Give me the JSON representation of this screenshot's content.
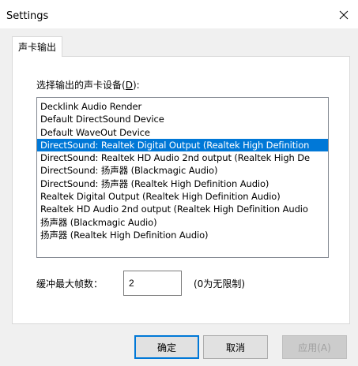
{
  "window": {
    "title": "Settings",
    "close_label": "×"
  },
  "tabs": [
    {
      "label": "声卡输出",
      "active": true
    }
  ],
  "device_group": {
    "label": "选择输出的声卡设备(D):",
    "label_prefix": "选择输出的声卡设备(",
    "label_accel": "D",
    "label_suffix": "):"
  },
  "devices": {
    "items": [
      "Decklink Audio Render",
      "Default DirectSound Device",
      "Default WaveOut Device",
      "DirectSound: Realtek Digital Output (Realtek High Definition",
      "DirectSound: Realtek HD Audio 2nd output (Realtek High De",
      "DirectSound: 扬声器 (Blackmagic Audio)",
      "DirectSound: 扬声器 (Realtek High Definition Audio)",
      "Realtek Digital Output (Realtek High Definition Audio)",
      "Realtek HD Audio 2nd output (Realtek High Definition Audio",
      "扬声器 (Blackmagic Audio)",
      "扬声器 (Realtek High Definition Audio)"
    ],
    "selected_index": 3
  },
  "max_frames": {
    "label": "缓冲最大帧数：",
    "value": "2",
    "hint": "(0为无限制)"
  },
  "buttons": {
    "ok": "确定",
    "cancel": "取消",
    "apply": "应用(A)"
  },
  "colors": {
    "selection": "#0078d7",
    "client_bg": "#f0f0f0"
  }
}
